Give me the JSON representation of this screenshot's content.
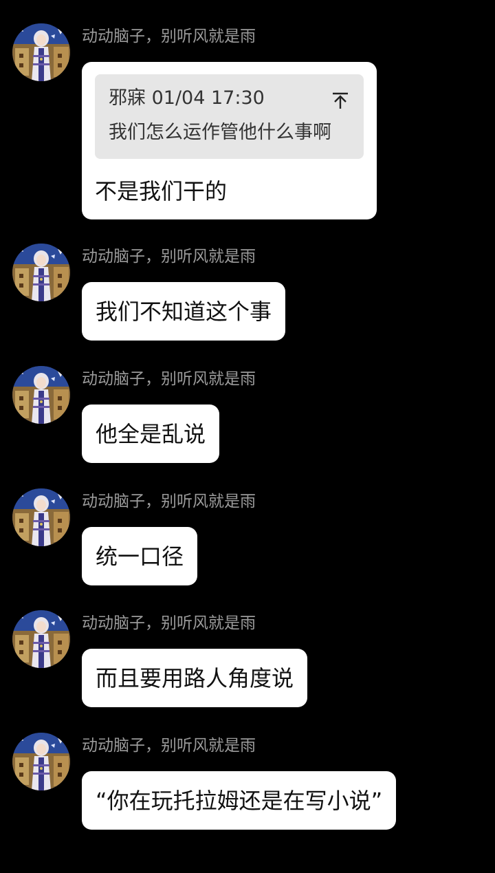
{
  "chat": {
    "quoted": {
      "author": "邪寐",
      "time": "01/04 17:30",
      "text": "我们怎么运作管他什么事啊"
    },
    "messages": [
      {
        "sender": "动动脑子，别听风就是雨",
        "text": "不是我们干的"
      },
      {
        "sender": "动动脑子，别听风就是雨",
        "text": "我们不知道这个事"
      },
      {
        "sender": "动动脑子，别听风就是雨",
        "text": "他全是乱说"
      },
      {
        "sender": "动动脑子，别听风就是雨",
        "text": "统一口径"
      },
      {
        "sender": "动动脑子，别听风就是雨",
        "text": "而且要用路人角度说"
      },
      {
        "sender": "动动脑子，别听风就是雨",
        "text": "“你在玩托拉姆还是在写小说”"
      }
    ]
  },
  "icons": {
    "avatar": "anime-character-avatar",
    "jump": "jump-to-quoted-message-arrow"
  }
}
